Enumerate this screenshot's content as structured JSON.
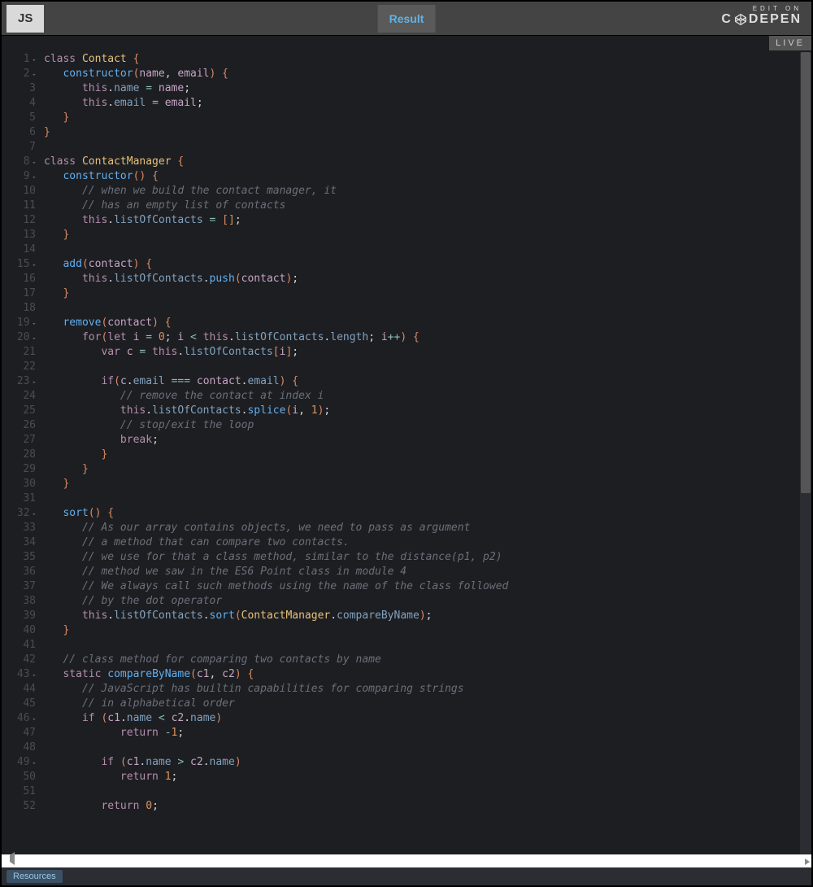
{
  "topbar": {
    "js_tab": "JS",
    "result_tab": "Result",
    "edit_on": "EDIT ON",
    "brand": "C   DEPEN"
  },
  "live_badge": "LIVE",
  "footer": {
    "resources": "Resources"
  },
  "code_lines": [
    {
      "n": 1,
      "fold": true,
      "tokens": [
        [
          "kw",
          "class"
        ],
        [
          "pl",
          " "
        ],
        [
          "cls",
          "Contact"
        ],
        [
          "pl",
          " "
        ],
        [
          "pn",
          "{"
        ]
      ]
    },
    {
      "n": 2,
      "fold": true,
      "indent": 1,
      "tokens": [
        [
          "fnname",
          "constructor"
        ],
        [
          "pn",
          "("
        ],
        [
          "id",
          "name"
        ],
        [
          "pl",
          ", "
        ],
        [
          "id",
          "email"
        ],
        [
          "pn",
          ")"
        ],
        [
          "pl",
          " "
        ],
        [
          "pn",
          "{"
        ]
      ]
    },
    {
      "n": 3,
      "indent": 2,
      "tokens": [
        [
          "kw",
          "this"
        ],
        [
          "pl",
          "."
        ],
        [
          "pr",
          "name"
        ],
        [
          "pl",
          " "
        ],
        [
          "op",
          "="
        ],
        [
          "pl",
          " "
        ],
        [
          "id",
          "name"
        ],
        [
          "pl",
          ";"
        ]
      ]
    },
    {
      "n": 4,
      "indent": 2,
      "tokens": [
        [
          "kw",
          "this"
        ],
        [
          "pl",
          "."
        ],
        [
          "pr",
          "email"
        ],
        [
          "pl",
          " "
        ],
        [
          "op",
          "="
        ],
        [
          "pl",
          " "
        ],
        [
          "id",
          "email"
        ],
        [
          "pl",
          ";"
        ]
      ]
    },
    {
      "n": 5,
      "indent": 1,
      "tokens": [
        [
          "pn",
          "}"
        ]
      ]
    },
    {
      "n": 6,
      "tokens": [
        [
          "pn",
          "}"
        ]
      ]
    },
    {
      "n": 7,
      "tokens": []
    },
    {
      "n": 8,
      "fold": true,
      "tokens": [
        [
          "kw",
          "class"
        ],
        [
          "pl",
          " "
        ],
        [
          "cls",
          "ContactManager"
        ],
        [
          "pl",
          " "
        ],
        [
          "pn",
          "{"
        ]
      ]
    },
    {
      "n": 9,
      "fold": true,
      "indent": 1,
      "tokens": [
        [
          "fnname",
          "constructor"
        ],
        [
          "pn",
          "()"
        ],
        [
          "pl",
          " "
        ],
        [
          "pn",
          "{"
        ]
      ]
    },
    {
      "n": 10,
      "indent": 2,
      "tokens": [
        [
          "cm",
          "// when we build the contact manager, it"
        ]
      ]
    },
    {
      "n": 11,
      "indent": 2,
      "tokens": [
        [
          "cm",
          "// has an empty list of contacts"
        ]
      ]
    },
    {
      "n": 12,
      "indent": 2,
      "tokens": [
        [
          "kw",
          "this"
        ],
        [
          "pl",
          "."
        ],
        [
          "pr",
          "listOfContacts"
        ],
        [
          "pl",
          " "
        ],
        [
          "op",
          "="
        ],
        [
          "pl",
          " "
        ],
        [
          "pn",
          "[]"
        ],
        [
          "pl",
          ";"
        ]
      ]
    },
    {
      "n": 13,
      "indent": 1,
      "tokens": [
        [
          "pn",
          "}"
        ]
      ]
    },
    {
      "n": 14,
      "tokens": []
    },
    {
      "n": 15,
      "fold": true,
      "indent": 1,
      "tokens": [
        [
          "fnname",
          "add"
        ],
        [
          "pn",
          "("
        ],
        [
          "id",
          "contact"
        ],
        [
          "pn",
          ")"
        ],
        [
          "pl",
          " "
        ],
        [
          "pn",
          "{"
        ]
      ]
    },
    {
      "n": 16,
      "indent": 2,
      "tokens": [
        [
          "kw",
          "this"
        ],
        [
          "pl",
          "."
        ],
        [
          "pr",
          "listOfContacts"
        ],
        [
          "pl",
          "."
        ],
        [
          "fnname",
          "push"
        ],
        [
          "pn",
          "("
        ],
        [
          "id",
          "contact"
        ],
        [
          "pn",
          ")"
        ],
        [
          "pl",
          ";"
        ]
      ]
    },
    {
      "n": 17,
      "indent": 1,
      "tokens": [
        [
          "pn",
          "}"
        ]
      ]
    },
    {
      "n": 18,
      "tokens": []
    },
    {
      "n": 19,
      "fold": true,
      "indent": 1,
      "tokens": [
        [
          "fnname",
          "remove"
        ],
        [
          "pn",
          "("
        ],
        [
          "id",
          "contact"
        ],
        [
          "pn",
          ")"
        ],
        [
          "pl",
          " "
        ],
        [
          "pn",
          "{"
        ]
      ]
    },
    {
      "n": 20,
      "fold": true,
      "indent": 2,
      "tokens": [
        [
          "kw",
          "for"
        ],
        [
          "pn",
          "("
        ],
        [
          "kw",
          "let"
        ],
        [
          "pl",
          " "
        ],
        [
          "id",
          "i"
        ],
        [
          "pl",
          " "
        ],
        [
          "op",
          "="
        ],
        [
          "pl",
          " "
        ],
        [
          "nm",
          "0"
        ],
        [
          "pl",
          "; "
        ],
        [
          "id",
          "i"
        ],
        [
          "pl",
          " "
        ],
        [
          "op",
          "<"
        ],
        [
          "pl",
          " "
        ],
        [
          "kw",
          "this"
        ],
        [
          "pl",
          "."
        ],
        [
          "pr",
          "listOfContacts"
        ],
        [
          "pl",
          "."
        ],
        [
          "pr",
          "length"
        ],
        [
          "pl",
          "; "
        ],
        [
          "id",
          "i"
        ],
        [
          "op",
          "++"
        ],
        [
          "pn",
          ")"
        ],
        [
          "pl",
          " "
        ],
        [
          "pn",
          "{"
        ]
      ]
    },
    {
      "n": 21,
      "indent": 3,
      "tokens": [
        [
          "kw",
          "var"
        ],
        [
          "pl",
          " "
        ],
        [
          "id",
          "c"
        ],
        [
          "pl",
          " "
        ],
        [
          "op",
          "="
        ],
        [
          "pl",
          " "
        ],
        [
          "kw",
          "this"
        ],
        [
          "pl",
          "."
        ],
        [
          "pr",
          "listOfContacts"
        ],
        [
          "pn",
          "["
        ],
        [
          "id",
          "i"
        ],
        [
          "pn",
          "]"
        ],
        [
          "pl",
          ";"
        ]
      ]
    },
    {
      "n": 22,
      "tokens": []
    },
    {
      "n": 23,
      "fold": true,
      "indent": 3,
      "tokens": [
        [
          "kw",
          "if"
        ],
        [
          "pn",
          "("
        ],
        [
          "id",
          "c"
        ],
        [
          "pl",
          "."
        ],
        [
          "pr",
          "email"
        ],
        [
          "pl",
          " "
        ],
        [
          "op",
          "==="
        ],
        [
          "pl",
          " "
        ],
        [
          "id",
          "contact"
        ],
        [
          "pl",
          "."
        ],
        [
          "pr",
          "email"
        ],
        [
          "pn",
          ")"
        ],
        [
          "pl",
          " "
        ],
        [
          "pn",
          "{"
        ]
      ]
    },
    {
      "n": 24,
      "indent": 4,
      "tokens": [
        [
          "cm",
          "// remove the contact at index i"
        ]
      ]
    },
    {
      "n": 25,
      "indent": 4,
      "tokens": [
        [
          "kw",
          "this"
        ],
        [
          "pl",
          "."
        ],
        [
          "pr",
          "listOfContacts"
        ],
        [
          "pl",
          "."
        ],
        [
          "fnname",
          "splice"
        ],
        [
          "pn",
          "("
        ],
        [
          "id",
          "i"
        ],
        [
          "pl",
          ", "
        ],
        [
          "nm",
          "1"
        ],
        [
          "pn",
          ")"
        ],
        [
          "pl",
          ";"
        ]
      ]
    },
    {
      "n": 26,
      "indent": 4,
      "tokens": [
        [
          "cm",
          "// stop/exit the loop"
        ]
      ]
    },
    {
      "n": 27,
      "indent": 4,
      "tokens": [
        [
          "kw",
          "break"
        ],
        [
          "pl",
          ";"
        ]
      ]
    },
    {
      "n": 28,
      "indent": 3,
      "tokens": [
        [
          "pn",
          "}"
        ]
      ]
    },
    {
      "n": 29,
      "indent": 2,
      "tokens": [
        [
          "pn",
          "}"
        ]
      ]
    },
    {
      "n": 30,
      "indent": 1,
      "tokens": [
        [
          "pn",
          "}"
        ]
      ]
    },
    {
      "n": 31,
      "tokens": []
    },
    {
      "n": 32,
      "fold": true,
      "indent": 1,
      "tokens": [
        [
          "fnname",
          "sort"
        ],
        [
          "pn",
          "()"
        ],
        [
          "pl",
          " "
        ],
        [
          "pn",
          "{"
        ]
      ]
    },
    {
      "n": 33,
      "indent": 2,
      "tokens": [
        [
          "cm",
          "// As our array contains objects, we need to pass as argument"
        ]
      ]
    },
    {
      "n": 34,
      "indent": 2,
      "tokens": [
        [
          "cm",
          "// a method that can compare two contacts."
        ]
      ]
    },
    {
      "n": 35,
      "indent": 2,
      "tokens": [
        [
          "cm",
          "// we use for that a class method, similar to the distance(p1, p2)"
        ]
      ]
    },
    {
      "n": 36,
      "indent": 2,
      "tokens": [
        [
          "cm",
          "// method we saw in the ES6 Point class in module 4"
        ]
      ]
    },
    {
      "n": 37,
      "indent": 2,
      "tokens": [
        [
          "cm",
          "// We always call such methods using the name of the class followed"
        ]
      ]
    },
    {
      "n": 38,
      "indent": 2,
      "tokens": [
        [
          "cm",
          "// by the dot operator"
        ]
      ]
    },
    {
      "n": 39,
      "indent": 2,
      "tokens": [
        [
          "kw",
          "this"
        ],
        [
          "pl",
          "."
        ],
        [
          "pr",
          "listOfContacts"
        ],
        [
          "pl",
          "."
        ],
        [
          "fnname",
          "sort"
        ],
        [
          "pn",
          "("
        ],
        [
          "cls",
          "ContactManager"
        ],
        [
          "pl",
          "."
        ],
        [
          "pr",
          "compareByName"
        ],
        [
          "pn",
          ")"
        ],
        [
          "pl",
          ";"
        ]
      ]
    },
    {
      "n": 40,
      "indent": 1,
      "tokens": [
        [
          "pn",
          "}"
        ]
      ]
    },
    {
      "n": 41,
      "tokens": []
    },
    {
      "n": 42,
      "indent": 1,
      "tokens": [
        [
          "cm",
          "// class method for comparing two contacts by name"
        ]
      ]
    },
    {
      "n": 43,
      "fold": true,
      "indent": 1,
      "tokens": [
        [
          "kw",
          "static"
        ],
        [
          "pl",
          " "
        ],
        [
          "fnname",
          "compareByName"
        ],
        [
          "pn",
          "("
        ],
        [
          "id",
          "c1"
        ],
        [
          "pl",
          ", "
        ],
        [
          "id",
          "c2"
        ],
        [
          "pn",
          ")"
        ],
        [
          "pl",
          " "
        ],
        [
          "pn",
          "{"
        ]
      ]
    },
    {
      "n": 44,
      "indent": 2,
      "tokens": [
        [
          "cm",
          "// JavaScript has builtin capabilities for comparing strings"
        ]
      ]
    },
    {
      "n": 45,
      "indent": 2,
      "tokens": [
        [
          "cm",
          "// in alphabetical order"
        ]
      ]
    },
    {
      "n": 46,
      "fold": true,
      "indent": 2,
      "tokens": [
        [
          "kw",
          "if"
        ],
        [
          "pl",
          " "
        ],
        [
          "pn",
          "("
        ],
        [
          "id",
          "c1"
        ],
        [
          "pl",
          "."
        ],
        [
          "pr",
          "name"
        ],
        [
          "pl",
          " "
        ],
        [
          "op",
          "<"
        ],
        [
          "pl",
          " "
        ],
        [
          "id",
          "c2"
        ],
        [
          "pl",
          "."
        ],
        [
          "pr",
          "name"
        ],
        [
          "pn",
          ")"
        ]
      ]
    },
    {
      "n": 47,
      "indent": 4,
      "tokens": [
        [
          "kw",
          "return"
        ],
        [
          "pl",
          " "
        ],
        [
          "op",
          "-"
        ],
        [
          "nm",
          "1"
        ],
        [
          "pl",
          ";"
        ]
      ]
    },
    {
      "n": 48,
      "tokens": []
    },
    {
      "n": 49,
      "fold": true,
      "indent": 3,
      "tokens": [
        [
          "kw",
          "if"
        ],
        [
          "pl",
          " "
        ],
        [
          "pn",
          "("
        ],
        [
          "id",
          "c1"
        ],
        [
          "pl",
          "."
        ],
        [
          "pr",
          "name"
        ],
        [
          "pl",
          " "
        ],
        [
          "op",
          ">"
        ],
        [
          "pl",
          " "
        ],
        [
          "id",
          "c2"
        ],
        [
          "pl",
          "."
        ],
        [
          "pr",
          "name"
        ],
        [
          "pn",
          ")"
        ]
      ]
    },
    {
      "n": 50,
      "indent": 4,
      "tokens": [
        [
          "kw",
          "return"
        ],
        [
          "pl",
          " "
        ],
        [
          "nm",
          "1"
        ],
        [
          "pl",
          ";"
        ]
      ]
    },
    {
      "n": 51,
      "tokens": []
    },
    {
      "n": 52,
      "indent": 3,
      "tokens": [
        [
          "kw",
          "return"
        ],
        [
          "pl",
          " "
        ],
        [
          "nm",
          "0"
        ],
        [
          "pl",
          ";"
        ]
      ]
    }
  ]
}
